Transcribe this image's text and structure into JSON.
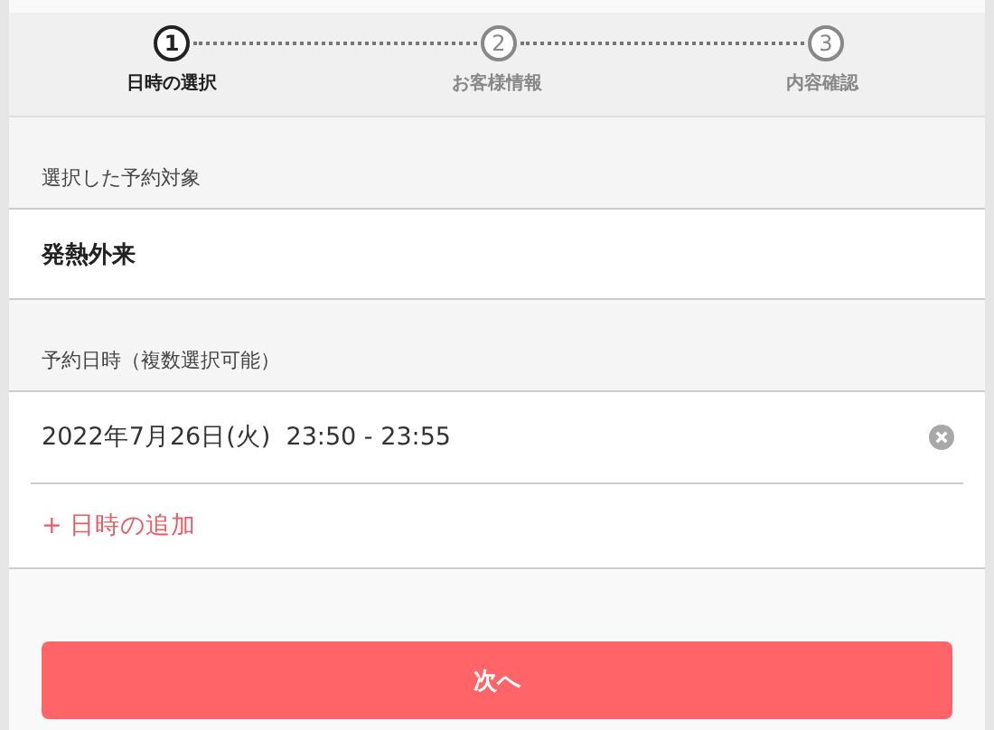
{
  "steps": [
    {
      "number": "1",
      "label": "日時の選択",
      "selected": true
    },
    {
      "number": "2",
      "label": "お客様情報",
      "selected": false
    },
    {
      "number": "3",
      "label": "内容確認",
      "selected": false
    }
  ],
  "target": {
    "heading": "選択した予約対象",
    "value": "発熱外来"
  },
  "datetime": {
    "heading": "予約日時（複数選択可能）",
    "entries": [
      "2022年7月26日(火)  23:50 - 23:55"
    ],
    "add_link": "+ 日時の追加"
  },
  "next_button": "次へ"
}
